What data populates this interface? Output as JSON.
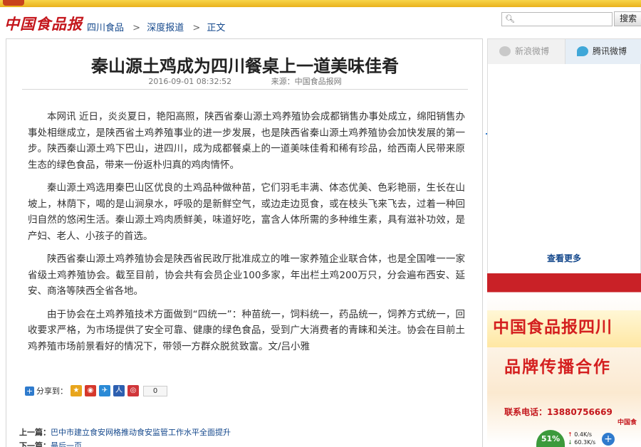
{
  "site": {
    "logo": "中国食品报",
    "breadcrumb": [
      "四川食品",
      "深度报道",
      "正文"
    ],
    "breadcrumb_sep": ">"
  },
  "search": {
    "placeholder": "",
    "button_label": "搜索"
  },
  "article": {
    "title": "秦山源土鸡成为四川餐桌上一道美味佳肴",
    "datetime": "2016-09-01 08:32:52",
    "source": "来源：中国食品报网",
    "paragraphs": [
      "本网讯 近日，炎炎夏日，艳阳高照，陕西省秦山源土鸡养殖协会成都销售办事处成立，绵阳销售办事处相继成立，是陕西省土鸡养殖事业的进一步发展，也是陕西省秦山源土鸡养殖协会加快发展的第一步。陕西秦山源土鸡下巴山，进四川，成为成都餐桌上的一道美味佳肴和稀有珍品，给西南人民带来原生态的绿色食品，带来一份返朴归真的鸡肉情怀。",
      "秦山源土鸡选用秦巴山区优良的土鸡品种做种苗，它们羽毛丰满、体态优美、色彩艳丽，生长在山坡上，林荫下，喝的是山涧泉水，呼吸的是新鲜空气，或边走边觅食，或在枝头飞来飞去，过着一种回归自然的悠闲生活。秦山源土鸡肉质鲜美，味道好吃，富含人体所需的多种维生素，具有滋补功效，是产妇、老人、小孩子的首选。",
      "陕西省秦山源土鸡养殖协会是陕西省民政厅批准成立的唯一家养殖企业联合体，也是全国唯一一家省级土鸡养殖协会。截至目前，协会共有会员企业100多家，年出栏土鸡200万只，分会遍布西安、延安、商洛等陕西全省各地。",
      "由于协会在土鸡养殖技术方面做到“四统一”：种苗统一，饲料统一，药品统一，饲养方式统一，回收要求严格，为市场提供了安全可靠、健康的绿色食品，受到广大消费者的青睐和关注。协会在目前土鸡养殖市场前景看好的情况下，带领一方群众脱贫致富。文/吕小雅"
    ],
    "share_label": "分享到：",
    "share_count": "0",
    "prev_label": "上一篇：",
    "prev_title": "巴中市建立食安网格推动食安监管工作水平全面提升",
    "next_label": "下一篇：",
    "next_title": "最后一页"
  },
  "sidebar": {
    "tabs": [
      "新浪微博",
      "腾讯微博"
    ],
    "see_more": "查看更多",
    "ad": {
      "line1": "中国食品报四川",
      "line2": "品牌传播合作",
      "phone": "联系电话：13880756669",
      "mark": "中国食"
    }
  },
  "widget": {
    "percent": "51%",
    "up": "0.4K/s",
    "down": "60.3K/s"
  },
  "colors": {
    "brand_red": "#c4161c",
    "link_blue": "#14488c",
    "ad_red": "#d41f1f"
  }
}
